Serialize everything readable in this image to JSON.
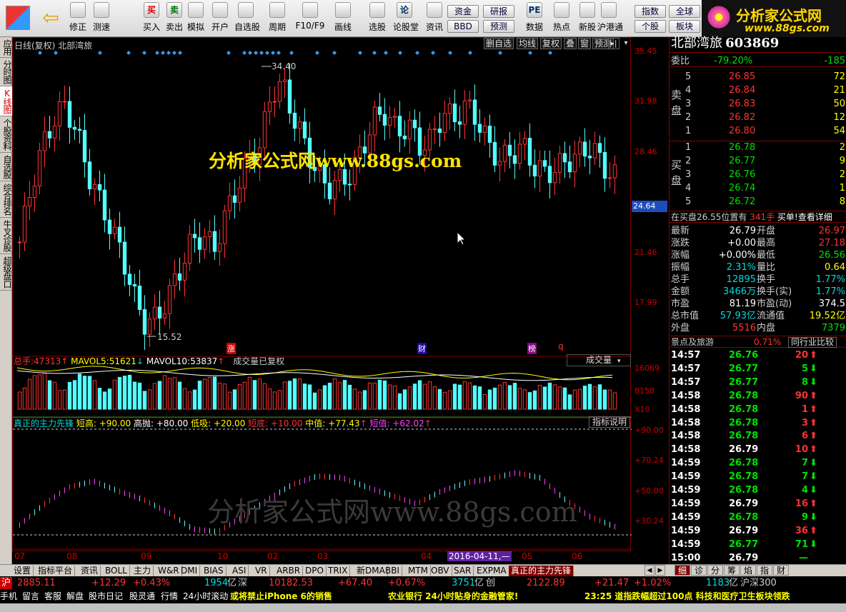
{
  "toolbar": {
    "buttons": [
      {
        "label": "修正",
        "icon": "arrow-up-down-icon"
      },
      {
        "label": "测速",
        "icon": "clock-icon"
      },
      {
        "label": "买入",
        "icon": "buy-icon",
        "glyph": "买"
      },
      {
        "label": "卖出",
        "icon": "sell-icon",
        "glyph": "卖"
      },
      {
        "label": "模拟",
        "icon": "hammer-icon"
      },
      {
        "label": "开户",
        "icon": "lock-icon"
      },
      {
        "label": "自选股",
        "icon": "star-icon"
      },
      {
        "label": "周期",
        "icon": "period-icon"
      },
      {
        "label": "F10/F9",
        "icon": "f10-icon"
      },
      {
        "label": "画线",
        "icon": "pencil-icon"
      },
      {
        "label": "选股",
        "icon": "screen-icon"
      },
      {
        "label": "论股堂",
        "icon": "lun-icon",
        "glyph": "论"
      },
      {
        "label": "资讯",
        "icon": "document-icon"
      },
      {
        "label": "数据",
        "icon": "pe-icon",
        "glyph": "PE"
      },
      {
        "label": "热点",
        "icon": "hot-icon"
      },
      {
        "label": "新股",
        "icon": "new-stock-icon"
      },
      {
        "label": "沪港通",
        "icon": "hk-icon"
      }
    ],
    "boxes": [
      "资金",
      "BBD",
      "研报",
      "预测",
      "指数",
      "全球",
      "个股",
      "板块"
    ]
  },
  "logo": {
    "title": "分析家公式网",
    "url": "www.88gs.com"
  },
  "side_tabs": [
    "应用",
    "分时图",
    "K线图",
    "个股资料",
    "自选股",
    "综合排名",
    "牛叉诊股",
    "超级盘口"
  ],
  "chart": {
    "title": "日线(复权)  北部湾旅",
    "buttons": [
      "删自选",
      "均线",
      "复权",
      "叠",
      "窗",
      "预测"
    ],
    "price_axis": [
      "35.45",
      "31.98",
      "28.46",
      "24.64",
      "21.46",
      "17.99"
    ],
    "high_label": "34.40",
    "low_label": "15.52",
    "watermark1": "分析家公式网www.88gs.com",
    "watermark2": "分析家公式网www.88gs.com",
    "markers": [
      "涨",
      "财",
      "榜",
      "q"
    ],
    "volume": {
      "total_label": "总手:",
      "total": "47313",
      "ma5_label": "MAVOL5:",
      "ma5": "51621",
      "ma10_label": "MAVOL10:",
      "ma10": "53837",
      "note": "成交量已复权",
      "selector": "成交量",
      "axis": [
        "16069",
        "8158",
        "X10"
      ]
    },
    "indicator": {
      "name": "真正的主力先锋",
      "short_high": "短高: +90.00",
      "high_throw": "高抛: +80.00",
      "low_buy": "低吸: +20.00",
      "short_bottom": "短底: +10.00",
      "mid": "中值: +77.43",
      "short": "短值: +62.02",
      "help": "指标说明",
      "axis": [
        "+90.00",
        "+70.24",
        "+50.00",
        "+30.24"
      ]
    },
    "months": [
      "07",
      "08",
      "09",
      "10",
      "02",
      "03",
      "04",
      "2016-04-11,—",
      "05",
      "06"
    ]
  },
  "quote": {
    "name": "北部湾旅",
    "code": "603869",
    "weibi_label": "委比",
    "weibi": "-79.20%",
    "weicha": "-185",
    "sell_label": "卖盘",
    "buy_label": "买盘",
    "asks": [
      {
        "n": "5",
        "p": "26.85",
        "v": "72"
      },
      {
        "n": "4",
        "p": "26.84",
        "v": "21"
      },
      {
        "n": "3",
        "p": "26.83",
        "v": "50"
      },
      {
        "n": "2",
        "p": "26.82",
        "v": "12"
      },
      {
        "n": "1",
        "p": "26.80",
        "v": "54"
      }
    ],
    "bids": [
      {
        "n": "1",
        "p": "26.78",
        "v": "2"
      },
      {
        "n": "2",
        "p": "26.77",
        "v": "9"
      },
      {
        "n": "3",
        "p": "26.76",
        "v": "2"
      },
      {
        "n": "4",
        "p": "26.74",
        "v": "1"
      },
      {
        "n": "5",
        "p": "26.72",
        "v": "8"
      }
    ],
    "notice_pre": "在买盘26.55位置有",
    "notice_qty": "341手",
    "notice_post": "买单!查看详细",
    "stats": [
      [
        "最新",
        "26.79",
        "开盘",
        "26.97"
      ],
      [
        "涨跌",
        "+0.00",
        "最高",
        "27.18"
      ],
      [
        "涨幅",
        "+0.00%",
        "最低",
        "26.56"
      ],
      [
        "振幅",
        "2.31%",
        "量比",
        "0.64"
      ],
      [
        "总手",
        "12895",
        "换手",
        "1.77%"
      ],
      [
        "金额",
        "3466万",
        "换手(实)",
        "1.77%"
      ],
      [
        "市盈",
        "81.19",
        "市盈(动)",
        "374.5"
      ],
      [
        "总市值",
        "57.93亿",
        "流通值",
        "19.52亿"
      ],
      [
        "外盘",
        "5516",
        "内盘",
        "7379"
      ]
    ],
    "sector": "景点及旅游",
    "sector_pct": "0.71%",
    "peer_btn": "同行业比较",
    "ticks": [
      [
        "14:57",
        "26.76",
        "20",
        "up"
      ],
      [
        "14:57",
        "26.77",
        "5",
        "down"
      ],
      [
        "14:57",
        "26.77",
        "8",
        "down"
      ],
      [
        "14:58",
        "26.78",
        "90",
        "up"
      ],
      [
        "14:58",
        "26.78",
        "1",
        "up"
      ],
      [
        "14:58",
        "26.78",
        "3",
        "up"
      ],
      [
        "14:58",
        "26.78",
        "6",
        "up"
      ],
      [
        "14:58",
        "26.79",
        "10",
        "up"
      ],
      [
        "14:59",
        "26.78",
        "7",
        "down"
      ],
      [
        "14:59",
        "26.78",
        "7",
        "down"
      ],
      [
        "14:59",
        "26.78",
        "4",
        "down"
      ],
      [
        "14:59",
        "26.79",
        "16",
        "up"
      ],
      [
        "14:59",
        "26.78",
        "9",
        "down"
      ],
      [
        "14:59",
        "26.79",
        "36",
        "up"
      ],
      [
        "14:59",
        "26.77",
        "71",
        "down"
      ],
      [
        "15:00",
        "26.79",
        "—",
        "none"
      ]
    ]
  },
  "bottom_tabs": [
    "设置",
    "指标平台",
    "资讯",
    "BOLL",
    "主力",
    "W&R",
    "DMI",
    "BIAS",
    "ASI",
    "VR",
    "ARBR",
    "DPO",
    "TRIX",
    "新DMA",
    "BBI",
    "MTM",
    "OBV",
    "SAR",
    "EXPMA",
    "真正的主力先锋"
  ],
  "right_bottom_tabs": [
    "细",
    "诊",
    "分",
    "筹",
    "焰",
    "指",
    "财"
  ],
  "status": {
    "sh_label": "沪",
    "sh": "2885.11",
    "sh_chg": "+12.29",
    "sh_pct": "+0.43%",
    "sh_amt": "1954",
    "yi": "亿",
    "sz_label": "深",
    "sz": "10182.53",
    "sz_chg": "+67.40",
    "sz_pct": "+0.67%",
    "sz_amt": "3751",
    "cy_label": "创",
    "cy": "2122.89",
    "cy_chg": "+21.47",
    "cy_pct": "+1.02%",
    "hs_amt": "1183",
    "hs_label": "沪深300"
  },
  "news": {
    "items": [
      "手机",
      "留言",
      "客服",
      "解盘",
      "股市日记",
      "股灵通",
      "行情",
      "24小时滚动"
    ],
    "ticker1": "或将禁止iPhone 6的销售",
    "ticker2": "农业银行 24小时贴身的金融管家!",
    "ticker3": "23:25 道指跌幅超过100点 科技和医疗卫生板块领跌"
  }
}
